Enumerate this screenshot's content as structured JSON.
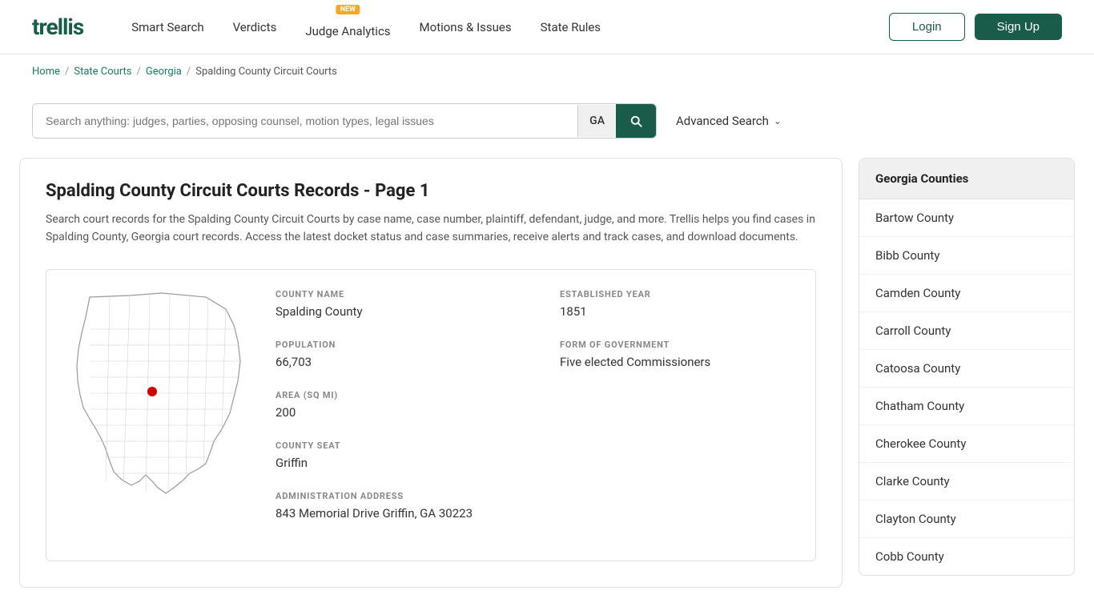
{
  "header": {
    "logo": "trellis",
    "nav": [
      {
        "label": "Smart Search",
        "badge": null
      },
      {
        "label": "Verdicts",
        "badge": null
      },
      {
        "label": "Judge Analytics",
        "badge": "NEW"
      },
      {
        "label": "Motions & Issues",
        "badge": null
      },
      {
        "label": "State Rules",
        "badge": null
      }
    ],
    "login_label": "Login",
    "signup_label": "Sign Up"
  },
  "breadcrumb": {
    "home": "Home",
    "state_courts": "State Courts",
    "state": "Georgia",
    "current": "Spalding County Circuit Courts"
  },
  "search": {
    "placeholder": "Search anything: judges, parties, opposing counsel, motion types, legal issues",
    "state_code": "GA",
    "advanced_label": "Advanced Search"
  },
  "content": {
    "page_title": "Spalding County Circuit Courts Records - Page 1",
    "description": "Search court records for the Spalding County Circuit Courts by case name, case number, plaintiff, defendant, judge, and more. Trellis helps you find cases in Spalding County, Georgia court records. Access the latest docket status and case summaries, receive alerts and track cases, and download documents.",
    "county_name_label": "COUNTY NAME",
    "county_name_value": "Spalding County",
    "established_year_label": "ESTABLISHED YEAR",
    "established_year_value": "1851",
    "population_label": "POPULATION",
    "population_value": "66,703",
    "form_of_govt_label": "FORM OF GOVERNMENT",
    "form_of_govt_value": "Five elected Commissioners",
    "area_label": "AREA (SQ MI)",
    "area_value": "200",
    "county_seat_label": "COUNTY SEAT",
    "county_seat_value": "Griffin",
    "admin_address_label": "ADMINISTRATION ADDRESS",
    "admin_address_value": "843 Memorial Drive Griffin, GA 30223"
  },
  "sidebar": {
    "header": "Georgia Counties",
    "items": [
      "Bartow County",
      "Bibb County",
      "Camden County",
      "Carroll County",
      "Catoosa County",
      "Chatham County",
      "Cherokee County",
      "Clarke County",
      "Clayton County",
      "Cobb County"
    ]
  }
}
